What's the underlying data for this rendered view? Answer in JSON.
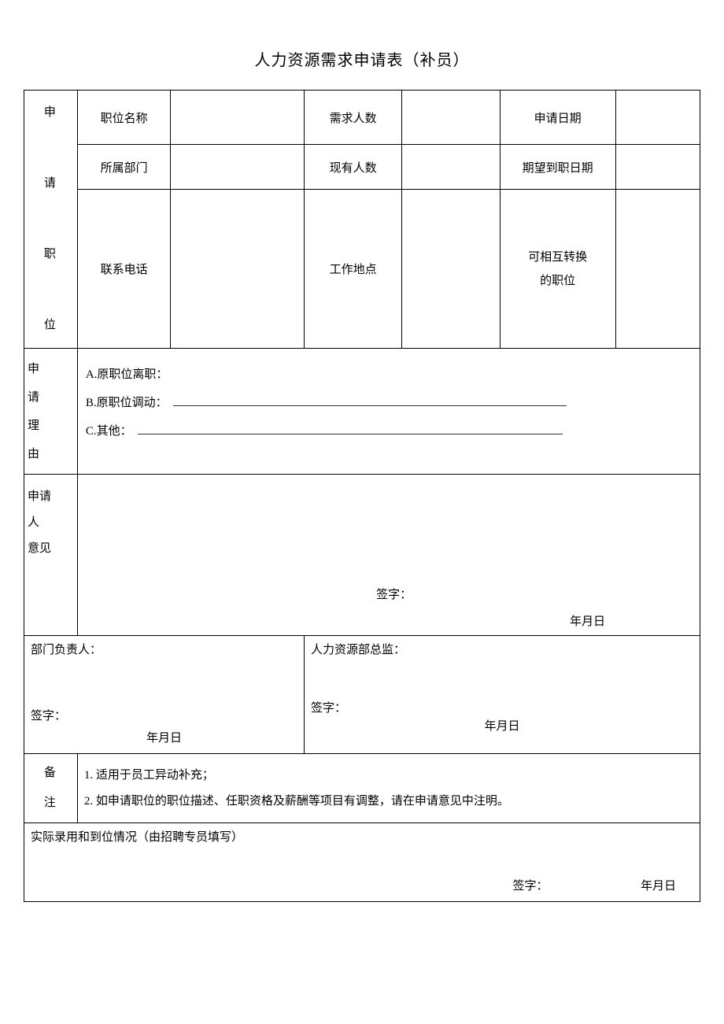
{
  "title": "人力资源需求申请表（补员）",
  "side": {
    "position": "申\n\n请\n\n职\n\n位"
  },
  "labels": {
    "jobName": "职位名称",
    "reqCount": "需求人数",
    "applyDate": "申请日期",
    "dept": "所属部门",
    "curCount": "现有人数",
    "expectDate": "期望到职日期",
    "phone": "联系电话",
    "workLoc": "工作地点",
    "interPos": "可相互转换\n的职位"
  },
  "reason": {
    "side": "申\n请\n理\n由",
    "a": "A.原职位离职：",
    "b": "B.原职位调动：",
    "c": "C.其他："
  },
  "opinion": {
    "side": "申请\n人\n意见",
    "sig": "签字：",
    "date": "年月日"
  },
  "deptHead": {
    "label": "部门负责人：",
    "sig": "签字：",
    "date": "年月日"
  },
  "hrHead": {
    "label": "人力资源部总监：",
    "sig": "签字：",
    "date": "年月日"
  },
  "remarks": {
    "side": "备\n注",
    "l1": "1. 适用于员工异动补充；",
    "l2": "2. 如申请职位的职位描述、任职资格及薪酬等项目有调整，请在申请意见中注明。"
  },
  "actual": {
    "label": "实际录用和到位情况（由招聘专员填写）",
    "sig": "签字：",
    "date": "年月日"
  }
}
